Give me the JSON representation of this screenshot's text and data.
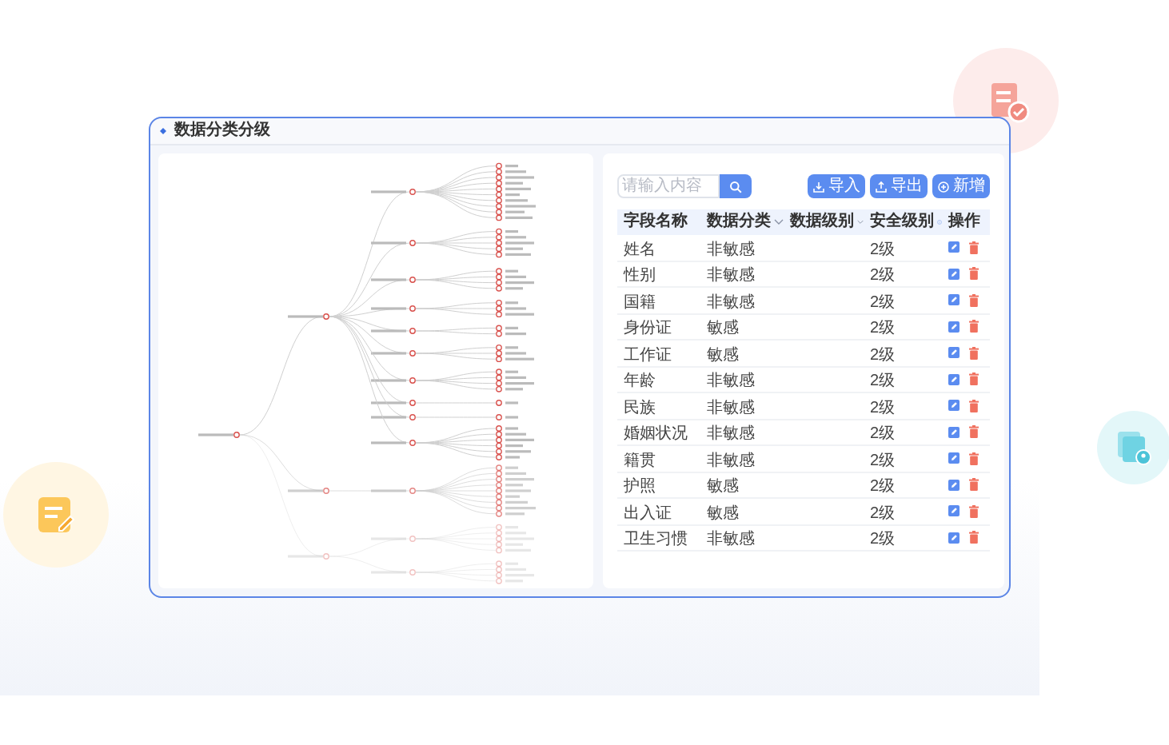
{
  "window": {
    "title": "数据分类分级"
  },
  "search": {
    "placeholder": "请输入内容"
  },
  "buttons": [
    {
      "kind": "import",
      "label": "导入"
    },
    {
      "kind": "export",
      "label": "导出"
    },
    {
      "kind": "add",
      "label": "新增"
    }
  ],
  "table": {
    "columns": [
      {
        "label": "字段名称",
        "sortable": false,
        "info": false
      },
      {
        "label": "数据分类",
        "sortable": true,
        "info": false
      },
      {
        "label": "数据级别",
        "sortable": true,
        "info": false
      },
      {
        "label": "安全级别",
        "sortable": false,
        "info": true
      },
      {
        "label": "操作",
        "sortable": false,
        "info": false
      }
    ],
    "rows": [
      {
        "name": "姓名",
        "category": "非敏感",
        "level": "2级"
      },
      {
        "name": "性别",
        "category": "非敏感",
        "level": "2级"
      },
      {
        "name": "国籍",
        "category": "非敏感",
        "level": "2级"
      },
      {
        "name": "身份证",
        "category": "敏感",
        "level": "2级"
      },
      {
        "name": "工作证",
        "category": "敏感",
        "level": "2级"
      },
      {
        "name": "年龄",
        "category": "非敏感",
        "level": "2级"
      },
      {
        "name": "民族",
        "category": "非敏感",
        "level": "2级"
      },
      {
        "name": "婚姻状况",
        "category": "非敏感",
        "level": "2级"
      },
      {
        "name": "籍贯",
        "category": "非敏感",
        "level": "2级"
      },
      {
        "name": "护照",
        "category": "敏感",
        "level": "2级"
      },
      {
        "name": "出入证",
        "category": "敏感",
        "level": "2级"
      },
      {
        "name": "卫生习惯",
        "category": "非敏感",
        "level": "2级"
      }
    ]
  }
}
